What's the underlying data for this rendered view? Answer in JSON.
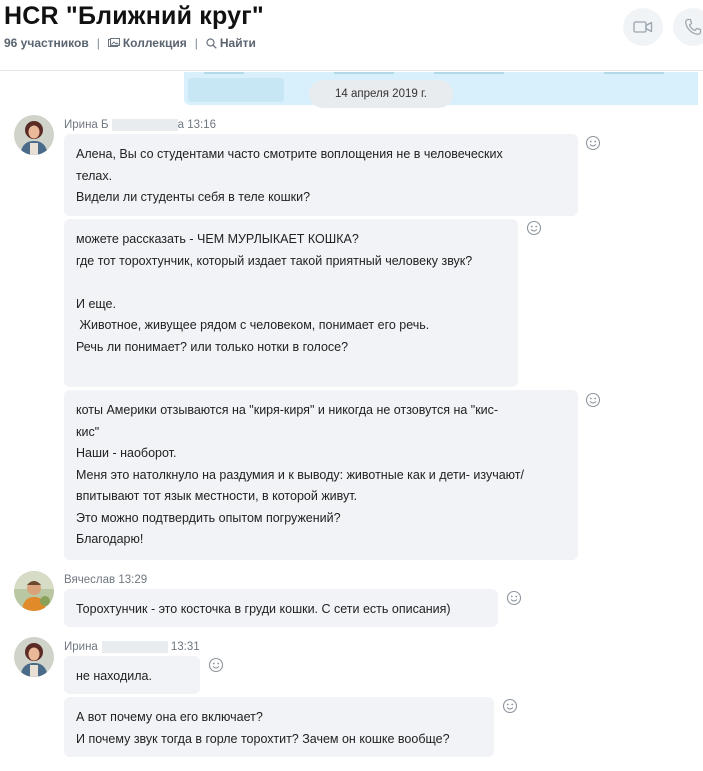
{
  "header": {
    "title": "HCR \"Ближний круг\"",
    "participants": "96 участников",
    "collection_label": "Коллекция",
    "find_label": "Найти",
    "video_icon": "video-camera-icon",
    "call_icon": "phone-icon"
  },
  "date_separator": "14 апреля 2019 г.",
  "messages": [
    {
      "sender_first": "Ирина Б",
      "sender_suffix": "а",
      "time": "13:16",
      "bubbles": [
        {
          "lines": [
            "Алена, Вы со студентами часто смотрите воплощения не в человеческих",
            "телах.",
            "Видели ли студенты себя в теле кошки?"
          ]
        },
        {
          "lines": [
            "можете рассказать - ЧЕМ МУРЛЫКАЕТ КОШКА?",
            "где тот торохтунчик, который издает такой приятный человеку звук?",
            "",
            "И еще.",
            " Животное, живущее рядом с человеком, понимает его речь.",
            "Речь ли понимает? или только нотки в голосе?"
          ]
        },
        {
          "lines": [
            "коты Америки отзываются на \"киря-киря\" и никогда не отзовутся на \"кис-",
            "кис\"",
            "Наши - наоборот.",
            "Меня это натолкнуло на раздумия и к выводу: животные как и дети- изучают/",
            "впитывают тот язык местности, в которой живут.",
            "Это можно подтвердить опытом погружений?",
            "Благодарю!"
          ]
        }
      ]
    },
    {
      "sender_first": "Вячеслав",
      "time": "13:29",
      "bubbles": [
        {
          "lines": [
            "Торохтунчик - это косточка в груди кошки. С сети есть описания)"
          ]
        }
      ]
    },
    {
      "sender_first": "Ирина",
      "time": "13:31",
      "bubbles": [
        {
          "lines": [
            "не находила."
          ]
        },
        {
          "lines": [
            "А вот почему она его включает?",
            "И почему звук тогда в горле торохтит? Зачем он кошке вообще?"
          ]
        }
      ]
    }
  ],
  "icons": {
    "reaction": "smiley-icon",
    "collection": "gallery-icon",
    "search": "search-icon"
  }
}
